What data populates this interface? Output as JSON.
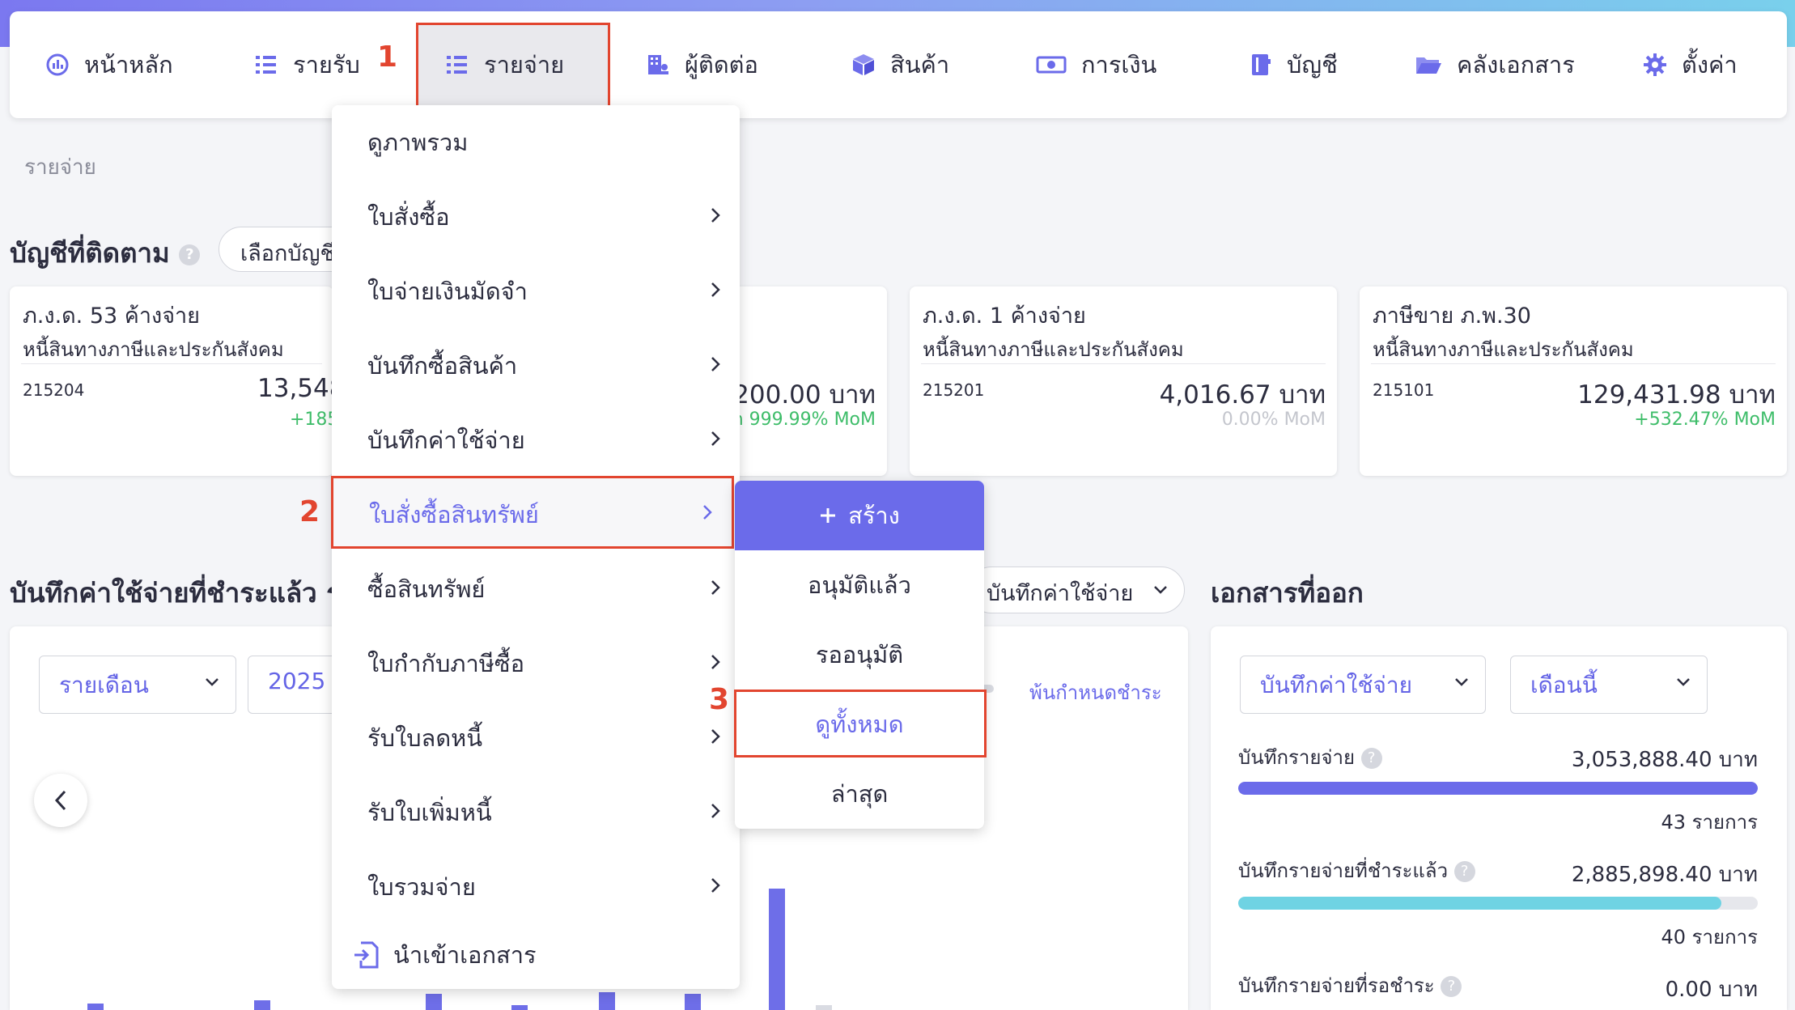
{
  "nav": {
    "items": [
      {
        "label": "หน้าหลัก",
        "icon": "dashboard-icon"
      },
      {
        "label": "รายรับ",
        "icon": "income-list-icon"
      },
      {
        "label": "รายจ่าย",
        "icon": "expense-list-icon"
      },
      {
        "label": "ผู้ติดต่อ",
        "icon": "contacts-building-icon"
      },
      {
        "label": "สินค้า",
        "icon": "box-icon"
      },
      {
        "label": "การเงิน",
        "icon": "money-icon"
      },
      {
        "label": "บัญชี",
        "icon": "ledger-book-icon"
      },
      {
        "label": "คลังเอกสาร",
        "icon": "folder-open-icon"
      },
      {
        "label": "ตั้งค่า",
        "icon": "gear-icon"
      }
    ],
    "active_index": 2
  },
  "annotations": {
    "step1": "1",
    "step2": "2",
    "step3": "3"
  },
  "breadcrumb": "รายจ่าย",
  "watched_accounts": {
    "title": "บัญชีที่ติดตาม",
    "select_label": "เลือกบัญชี",
    "cards": [
      {
        "name": "ภ.ง.ด. 53 ค้างจ่าย",
        "type": "หนี้สินทางภาษีและประกันสังคม",
        "code": "215204",
        "amount": "13,548",
        "mom": "+185"
      },
      {
        "amount": ",200.00 บาท",
        "mom": "n 999.99% MoM"
      },
      {
        "name": "ภ.ง.ด. 1 ค้างจ่าย",
        "type": "หนี้สินทางภาษีและประกันสังคม",
        "code": "215201",
        "amount": "4,016.67 บาท",
        "mom": "0.00% MoM"
      },
      {
        "name": "ภาษีขาย ภ.พ.30",
        "type": "หนี้สินทางภาษีและประกันสังคม",
        "code": "215101",
        "amount": "129,431.98 บาท",
        "mom": "+532.47% MoM"
      }
    ]
  },
  "paid_expenses": {
    "title": "บันทึกค่าใช้จ่ายที่ชำระแล้ว รอชำ",
    "period_select": "รายเดือน",
    "year_select": "2025",
    "doc_type_select": "บันทึกค่าใช้จ่าย",
    "legend_overdue": "พ้นกำหนดชำระ"
  },
  "chart_data": {
    "type": "bar",
    "series": [
      {
        "values": [
          1,
          1,
          1,
          1,
          1,
          1,
          1,
          1
        ]
      },
      {
        "values": [
          1
        ]
      }
    ]
  },
  "issued_docs": {
    "title": "เอกสารที่ออก",
    "doc_select": "บันทึกค่าใช้จ่าย",
    "period_select": "เดือนนี้",
    "stats": [
      {
        "label": "บันทึกรายจ่าย",
        "value": "3,053,888.40 บาท",
        "count": "43 รายการ",
        "progress": 1.0
      },
      {
        "label": "บันทึกรายจ่ายที่ชำระแล้ว",
        "value": "2,885,898.40 บาท",
        "count": "40 รายการ",
        "progress": 0.93
      },
      {
        "label": "บันทึกรายจ่ายที่รอชำระ",
        "value": "0.00 บาท",
        "count": "",
        "progress": 0
      }
    ]
  },
  "dropdown": {
    "items": [
      {
        "label": "ดูภาพรวม",
        "has_sub": false
      },
      {
        "label": "ใบสั่งซื้อ",
        "has_sub": true
      },
      {
        "label": "ใบจ่ายเงินมัดจำ",
        "has_sub": true
      },
      {
        "label": "บันทึกซื้อสินค้า",
        "has_sub": true
      },
      {
        "label": "บันทึกค่าใช้จ่าย",
        "has_sub": true
      },
      {
        "label": "ใบสั่งซื้อสินทรัพย์",
        "has_sub": true
      },
      {
        "label": "ซื้อสินทรัพย์",
        "has_sub": true
      },
      {
        "label": "ใบกำกับภาษีซื้อ",
        "has_sub": true
      },
      {
        "label": "รับใบลดหนี้",
        "has_sub": true
      },
      {
        "label": "รับใบเพิ่มหนี้",
        "has_sub": true
      },
      {
        "label": "ใบรวมจ่าย",
        "has_sub": true
      }
    ],
    "import_label": "นำเข้าเอกสาร"
  },
  "submenu": {
    "create_label": "สร้าง",
    "items": [
      "อนุมัติแล้ว",
      "รออนุมัติ",
      "ดูทั้งหมด",
      "ล่าสุด"
    ]
  },
  "colors": {
    "accent": "#6b6bea",
    "highlight_box": "#e2452f",
    "positive": "#3fbd6a",
    "teal": "#6fd3e3"
  }
}
